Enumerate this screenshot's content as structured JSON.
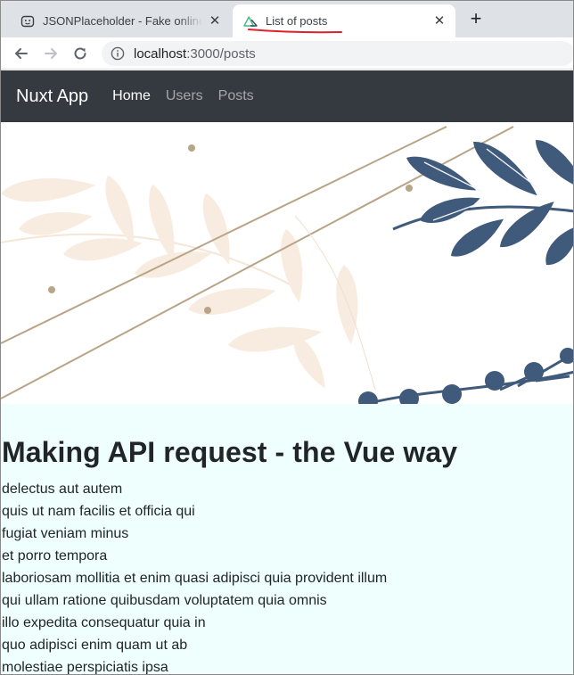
{
  "browser": {
    "tabs": [
      {
        "title": "JSONPlaceholder - Fake online REST API for developers",
        "icon": "jsonplaceholder-favicon-icon",
        "active": false
      },
      {
        "title": "List of posts",
        "icon": "nuxt-favicon-icon",
        "active": true
      }
    ],
    "close_glyph": "✕",
    "new_tab_glyph": "+",
    "url_host": "localhost",
    "url_path": ":3000/posts"
  },
  "navbar": {
    "brand": "Nuxt App",
    "links": [
      {
        "label": "Home",
        "active": true
      },
      {
        "label": "Users",
        "active": false
      },
      {
        "label": "Posts",
        "active": false
      }
    ],
    "background": "#343a40"
  },
  "hero": {
    "leaf_dark_color": "#3f5a7b",
    "leaf_light_color": "#f8ece0",
    "line_color": "#b8a486"
  },
  "main": {
    "heading": "Making API request - the Vue way",
    "background": "#effffe",
    "posts": [
      "delectus aut autem",
      "quis ut nam facilis et officia qui",
      "fugiat veniam minus",
      "et porro tempora",
      "laboriosam mollitia et enim quasi adipisci quia provident illum",
      "qui ullam ratione quibusdam voluptatem quia omnis",
      "illo expedita consequatur quia in",
      "quo adipisci enim quam ut ab",
      "molestiae perspiciatis ipsa"
    ]
  },
  "annotation": {
    "underline_color": "#e0202a"
  }
}
